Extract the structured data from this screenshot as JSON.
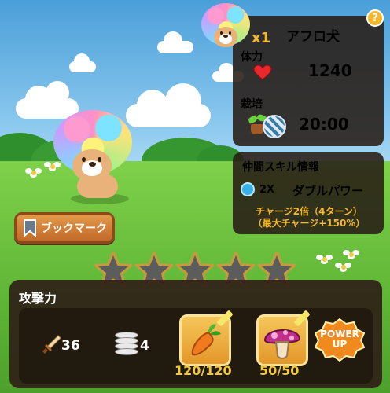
{
  "character": {
    "name": "アフロ犬",
    "level_badge": "x1",
    "help_glyph": "?"
  },
  "stats": {
    "hp_label": "体力",
    "hp_value": "1240",
    "cultivation_label": "栽培",
    "cultivation_time": "20:00"
  },
  "skill": {
    "title": "仲間スキル情報",
    "multiplier": "2X",
    "name": "ダブルパワー",
    "desc_line1": "チャージ2倍（4ターン）",
    "desc_line2": "（最大チャージ+150%）"
  },
  "bookmark": {
    "label": "ブックマーク"
  },
  "rank": {
    "stars_filled": 0,
    "stars_total": 5
  },
  "attack": {
    "label": "攻撃力",
    "sword_value": "36",
    "coin_value": "4",
    "carrot_count": "120/120",
    "mushroom_count": "50/50",
    "powerup_line1": "POWER",
    "powerup_line2": "UP"
  },
  "colors": {
    "accent": "#f4b82a",
    "panel": "#2f2119",
    "button": "#d4803a"
  }
}
